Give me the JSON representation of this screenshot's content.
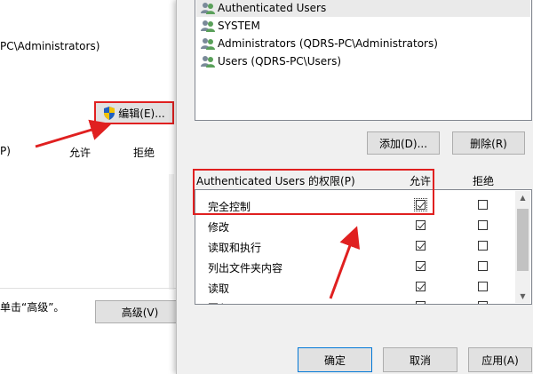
{
  "background_window": {
    "owner_text": "PC\\Administrators)",
    "edit_button": "编辑(E)...",
    "col_partial": "P)",
    "col_allow": "允许",
    "col_deny": "拒绝",
    "advanced_hint": "单击“高级”。",
    "advanced_button": "高级(V)"
  },
  "names": [
    {
      "label": "Authenticated Users",
      "selected": true
    },
    {
      "label": "SYSTEM",
      "selected": false
    },
    {
      "label": "Administrators (QDRS-PC\\Administrators)",
      "selected": false
    },
    {
      "label": "Users (QDRS-PC\\Users)",
      "selected": false
    }
  ],
  "buttons": {
    "add": "添加(D)...",
    "remove": "删除(R)",
    "ok": "确定",
    "cancel": "取消",
    "apply": "应用(A)"
  },
  "permissions": {
    "header": "Authenticated Users 的权限(P)",
    "allow": "允许",
    "deny": "拒绝",
    "rows": [
      {
        "label": "完全控制",
        "allow": true,
        "deny": false
      },
      {
        "label": "修改",
        "allow": true,
        "deny": false
      },
      {
        "label": "读取和执行",
        "allow": true,
        "deny": false
      },
      {
        "label": "列出文件夹内容",
        "allow": true,
        "deny": false
      },
      {
        "label": "读取",
        "allow": true,
        "deny": false
      },
      {
        "label": "写入",
        "allow": true,
        "deny": false
      }
    ]
  },
  "colors": {
    "highlight": "#e02020",
    "dialog_bg": "#f0f0f0"
  }
}
